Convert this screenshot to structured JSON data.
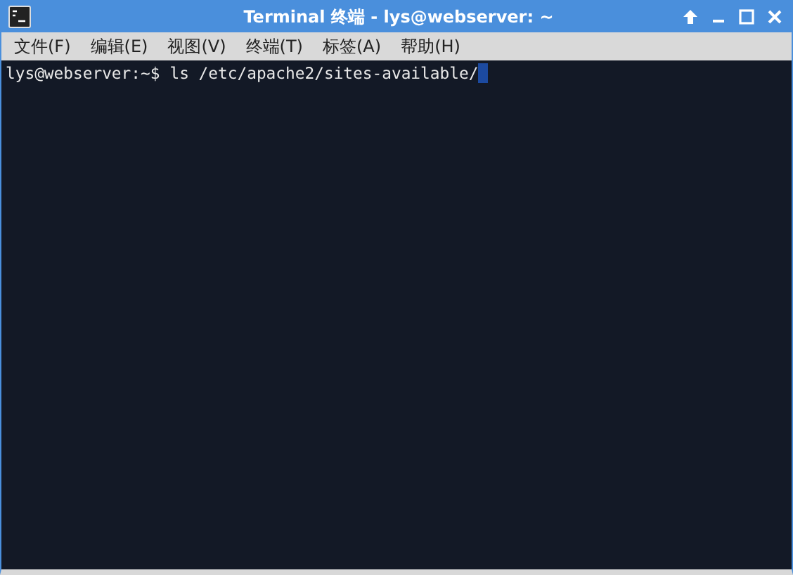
{
  "window": {
    "title": "Terminal 终端 - lys@webserver: ~"
  },
  "menu": [
    "文件(F)",
    "编辑(E)",
    "视图(V)",
    "终端(T)",
    "标签(A)",
    "帮助(H)"
  ],
  "terminal": {
    "prompt": "lys@webserver:~$",
    "command": "ls /etc/apache2/sites-available/",
    "cursor": true
  }
}
